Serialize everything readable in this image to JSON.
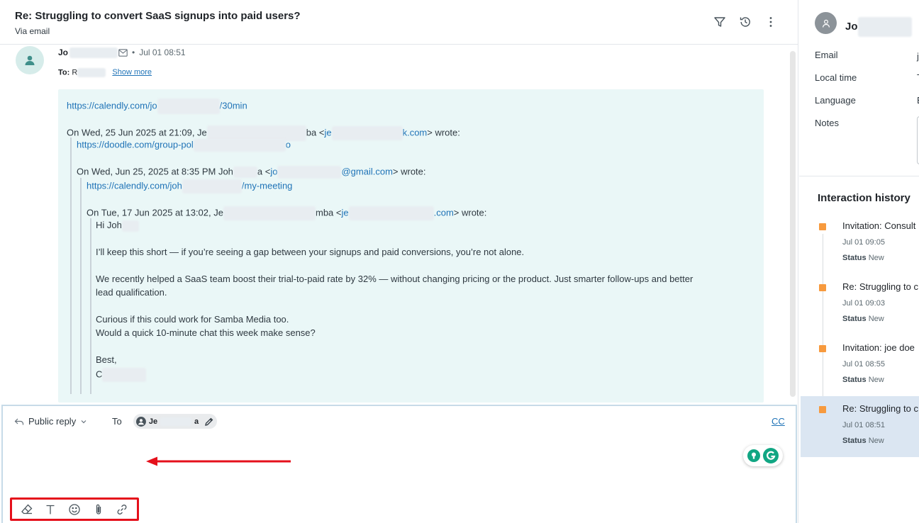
{
  "ticket": {
    "subject": "Re: Struggling to convert SaaS signups into paid users?",
    "via": "Via email"
  },
  "message": {
    "sender_prefix": "Jo",
    "date": "Jul 01 08:51",
    "to_label": "To:",
    "to_prefix": "R",
    "show_more": "Show more",
    "lines": {
      "l1_pre": "https://calendly.com/jo",
      "l1_post": "/30min",
      "l2_pre": "On Wed, 25 Jun 2025 at 21:09, Je",
      "l2_mid": "ba <",
      "l2_email_pre": "je",
      "l2_email_post": "k.com",
      "l2_post": "> wrote:",
      "l3_pre": "https://doodle.com/group-pol",
      "l3_post": "o",
      "l4_pre": "On Wed, Jun 25, 2025 at 8:35 PM Joh",
      "l4_mid": "a <",
      "l4_email_pre": "jo",
      "l4_email_post": "@gmail.com",
      "l4_post": "> wrote:",
      "l5_pre": "https://calendly.com/joh",
      "l5_post": "/my-meeting",
      "l6_pre": "On Tue, 17 Jun 2025 at 13:02, Je",
      "l6_mid": "mba <",
      "l6_email_pre": "je",
      "l6_email_post": ".com",
      "l6_post": "> wrote:",
      "greeting": "Hi Joh",
      "p1": "I’ll keep this short — if you’re seeing a gap between your signups and paid conversions, you’re not alone.",
      "p2a": "We recently helped a SaaS team boost their trial-to-paid rate by 32% — without changing pricing or the product. Just smarter follow-ups and better",
      "p2b": "lead qualification.",
      "p3a": "Curious if this could work for Samba Media too.",
      "p3b": "Would a quick 10-minute chat this week make sense?",
      "signoff": "Best,",
      "sig_prefix": "C"
    }
  },
  "composer": {
    "reply_type": "Public reply",
    "to_label": "To",
    "recipient_prefix": "Je",
    "recipient_suffix": "a",
    "cc": "CC"
  },
  "side": {
    "name_prefix": "Jo",
    "props": {
      "email_label": "Email",
      "email_value": "j",
      "local_time_label": "Local time",
      "local_time_value": "T",
      "language_label": "Language",
      "language_value": "E",
      "notes_label": "Notes"
    },
    "history_title": "Interaction history",
    "history": [
      {
        "title": "Invitation: Consult",
        "time": "Jul 01 09:05",
        "status_label": "Status",
        "status": "New"
      },
      {
        "title": "Re: Struggling to c",
        "time": "Jul 01 09:03",
        "status_label": "Status",
        "status": "New"
      },
      {
        "title": "Invitation: joe doe",
        "time": "Jul 01 08:55",
        "status_label": "Status",
        "status": "New"
      },
      {
        "title": "Re: Struggling to c",
        "time": "Jul 01 08:51",
        "status_label": "Status",
        "status": "New"
      }
    ]
  },
  "colors": {
    "accent_link": "#1f73b7",
    "quote_background": "#eaf7f7",
    "history_dot": "#f79a3e",
    "highlight_red": "#e5101b",
    "active_history_bg": "#dbe6f2"
  },
  "icons": {
    "header": [
      "filter-icon",
      "history-icon",
      "more-vertical-icon"
    ],
    "toolbar": [
      "eraser-icon",
      "text-format-icon",
      "emoji-icon",
      "paperclip-icon",
      "link-icon"
    ]
  }
}
